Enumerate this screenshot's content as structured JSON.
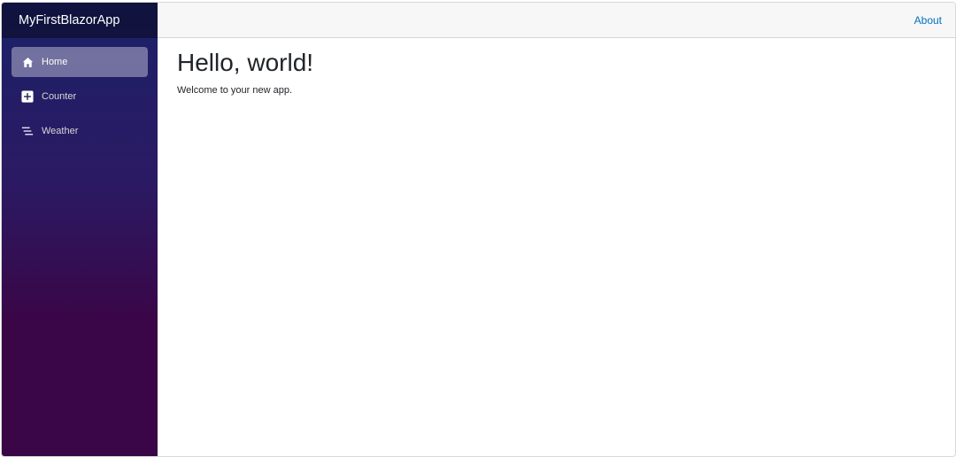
{
  "brand": {
    "title": "MyFirstBlazorApp"
  },
  "sidebar": {
    "items": [
      {
        "label": "Home",
        "icon": "home-icon",
        "active": true
      },
      {
        "label": "Counter",
        "icon": "plus-square-icon",
        "active": false
      },
      {
        "label": "Weather",
        "icon": "list-lines-icon",
        "active": false
      }
    ]
  },
  "header": {
    "about_label": "About"
  },
  "main": {
    "title": "Hello, world!",
    "welcome_text": "Welcome to your new app."
  },
  "colors": {
    "sidebar_top": "#1b2169",
    "sidebar_bottom": "#3a0647",
    "link": "#0071c1"
  }
}
